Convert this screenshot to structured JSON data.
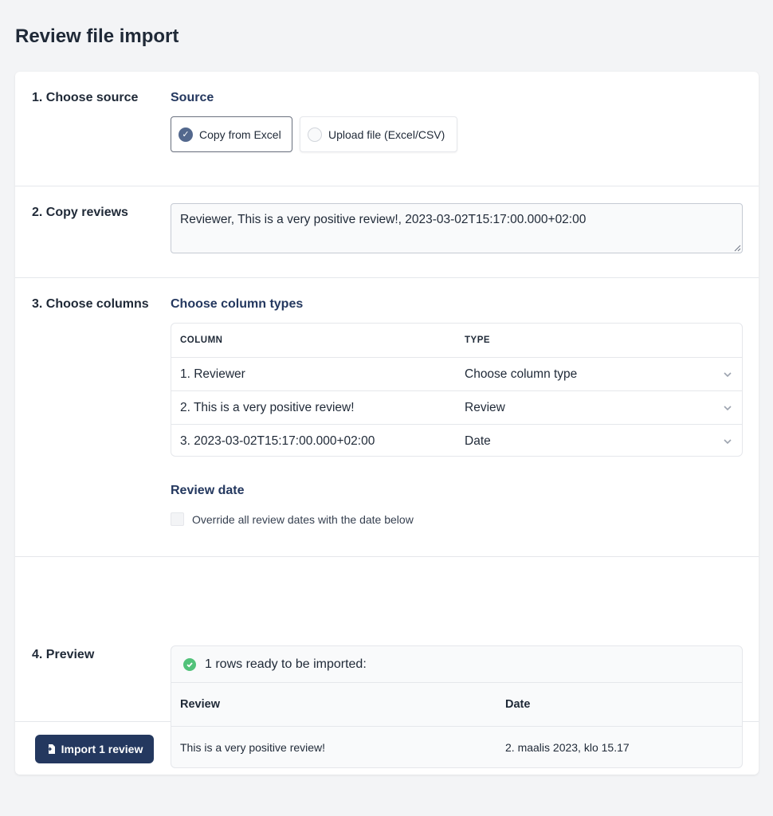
{
  "page": {
    "title": "Review file import"
  },
  "steps": {
    "source": {
      "label": "1. Choose source",
      "heading": "Source",
      "options": [
        {
          "label": "Copy from Excel",
          "selected": true
        },
        {
          "label": "Upload file (Excel/CSV)",
          "selected": false
        }
      ]
    },
    "copy": {
      "label": "2. Copy reviews",
      "textarea_value": "Reviewer, This is a very positive review!, 2023-03-02T15:17:00.000+02:00"
    },
    "columns": {
      "label": "3. Choose columns",
      "heading": "Choose column types",
      "headers": {
        "column": "COLUMN",
        "type": "TYPE"
      },
      "rows": [
        {
          "column": "1. Reviewer",
          "type": "Choose column type"
        },
        {
          "column": "2. This is a very positive review!",
          "type": "Review"
        },
        {
          "column": "3. 2023-03-02T15:17:00.000+02:00",
          "type": "Date"
        }
      ],
      "date_heading": "Review date",
      "override_label": "Override all review dates with the date below",
      "override_checked": false
    },
    "preview": {
      "label": "4. Preview",
      "status": "1 rows ready to be imported:",
      "headers": {
        "review": "Review",
        "date": "Date"
      },
      "rows": [
        {
          "review": "This is a very positive review!",
          "date": "2. maalis 2023, klo 15.17"
        }
      ]
    }
  },
  "footer": {
    "import_label": "Import 1 review",
    "import_icon": "file-import-icon"
  },
  "colors": {
    "accent": "#24385f",
    "radio_checked": "#53688d",
    "success": "#52c27a",
    "background": "#f3f4f6"
  }
}
